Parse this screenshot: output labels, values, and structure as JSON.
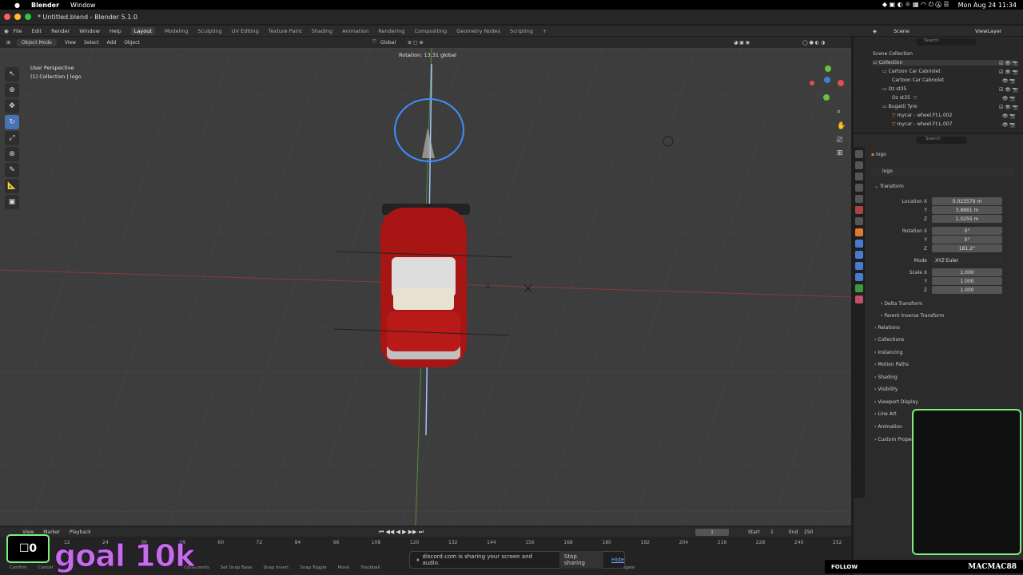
{
  "macbar": {
    "app": "Blender",
    "menu1": "Window",
    "datetime": "Mon Aug 24  11:34"
  },
  "window": {
    "title": "* Untitled.blend - Blender 5.1.0"
  },
  "menus": [
    "File",
    "Edit",
    "Render",
    "Window",
    "Help"
  ],
  "workspaces": [
    "Layout",
    "Modeling",
    "Sculpting",
    "UV Editing",
    "Texture Paint",
    "Shading",
    "Animation",
    "Rendering",
    "Compositing",
    "Geometry Nodes",
    "Scripting"
  ],
  "viewport": {
    "mode": "Object Mode",
    "menus": [
      "View",
      "Select",
      "Add",
      "Object"
    ],
    "orientation": "Global",
    "perspective": "User Perspective",
    "collection": "(1) Collection | logo",
    "rotation_readout": "Rotation: 13.31 global"
  },
  "topbar_right": {
    "scene": "Scene",
    "view_layer": "ViewLayer"
  },
  "outliner": {
    "search_placeholder": "Search",
    "items": [
      {
        "label": "Scene Collection"
      },
      {
        "label": "Collection"
      },
      {
        "label": "Cartoon Car Cabriolet"
      },
      {
        "label": "Cartoon Car Cabriolet"
      },
      {
        "label": "Oz st35"
      },
      {
        "label": "Oz st35"
      },
      {
        "label": "Bugatti Tyre"
      },
      {
        "label": "mycar - wheel.Ft.L.002"
      },
      {
        "label": "mycar - wheel.Ft.L.007"
      }
    ]
  },
  "properties": {
    "search_placeholder": "Search",
    "object_name": "logo",
    "object_field": "logo",
    "transform_label": "Transform",
    "location_label": "Location X",
    "location": [
      "0.023579 m",
      "3.8861 m",
      "1.0255 m"
    ],
    "rotation_label": "Rotation X",
    "rotation": [
      "0°",
      "0°",
      "181.2°"
    ],
    "mode_label": "Mode",
    "mode_value": "XYZ Euler",
    "scale_label": "Scale X",
    "scale": [
      "1.000",
      "1.000",
      "1.000"
    ],
    "axis_y": "Y",
    "axis_z": "Z",
    "subsections": [
      "Delta Transform",
      "Parent Inverse Transform"
    ],
    "sections": [
      "Relations",
      "Collections",
      "Instancing",
      "Motion Paths",
      "Shading",
      "Visibility",
      "Viewport Display",
      "Line Art",
      "Animation",
      "Custom Properties"
    ]
  },
  "timeline": {
    "menus": [
      "View",
      "Marker",
      "Playback"
    ],
    "current_frame": "1",
    "start_label": "Start",
    "start": "1",
    "end_label": "End",
    "end": "250",
    "ticks": [
      "12",
      "24",
      "36",
      "48",
      "60",
      "72",
      "84",
      "96",
      "108",
      "120",
      "132",
      "144",
      "156",
      "168",
      "180",
      "192",
      "204",
      "216",
      "228",
      "240",
      "252"
    ],
    "status": [
      "Confirm",
      "Cancel",
      "Constraints",
      "Set Snap Base",
      "Snap Invert",
      "Snap Toggle",
      "Move",
      "Trackball",
      "Navigate"
    ]
  },
  "overlay": {
    "counter": "0",
    "goal": "goal 10k",
    "follow": "FOLLOW",
    "channel": "MACMAC88"
  },
  "discord": {
    "message": "discord.com is sharing your screen and audio.",
    "stop": "Stop sharing",
    "hide": "Hide"
  },
  "colors": {
    "accent": "#4772b3",
    "green_frame": "#7cf07c",
    "car_red": "#b01818"
  }
}
